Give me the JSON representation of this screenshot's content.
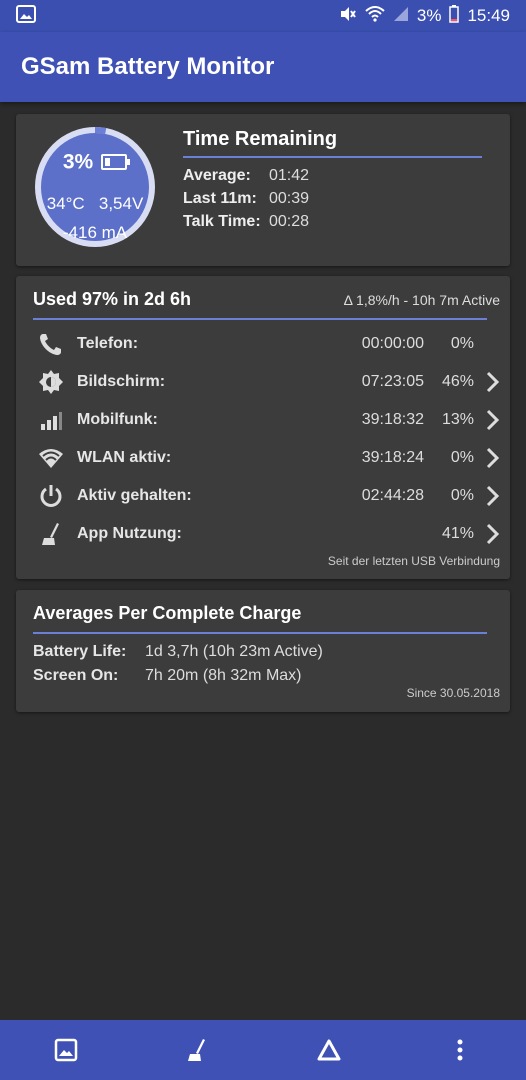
{
  "status_bar": {
    "battery_pct": "3%",
    "time": "15:49"
  },
  "app": {
    "title": "GSam Battery Monitor"
  },
  "gauge": {
    "percent": "3%",
    "level_fraction": 0.03,
    "temperature": "34°C",
    "voltage": "3,54V",
    "current": "-416 mA",
    "ring_color": "#d9ddf3",
    "fill_color": "#6b7fd7"
  },
  "time_remaining": {
    "title": "Time Remaining",
    "rows": [
      {
        "label": "Average:",
        "value": "01:42"
      },
      {
        "label": "Last 11m:",
        "value": "00:39"
      },
      {
        "label": "Talk Time:",
        "value": "00:28"
      }
    ]
  },
  "usage": {
    "title": "Used 97% in 2d 6h",
    "rate": "Δ 1,8%/h - 10h 7m Active",
    "rows": [
      {
        "icon": "phone-icon",
        "name": "Telefon:",
        "time": "00:00:00",
        "pct": "0%",
        "has_chevron": false
      },
      {
        "icon": "brightness-icon",
        "name": "Bildschirm:",
        "time": "07:23:05",
        "pct": "46%",
        "has_chevron": true
      },
      {
        "icon": "signal-icon",
        "name": "Mobilfunk:",
        "time": "39:18:32",
        "pct": "13%",
        "has_chevron": true
      },
      {
        "icon": "wifi-icon",
        "name": "WLAN aktiv:",
        "time": "39:18:24",
        "pct": "0%",
        "has_chevron": true
      },
      {
        "icon": "power-icon",
        "name": "Aktiv gehalten:",
        "time": "02:44:28",
        "pct": "0%",
        "has_chevron": true
      },
      {
        "icon": "broom-icon",
        "name": "App Nutzung:",
        "time": "",
        "pct": "41%",
        "has_chevron": true
      }
    ],
    "footer": "Seit der letzten USB Verbindung"
  },
  "averages": {
    "title": "Averages Per Complete Charge",
    "rows": [
      {
        "label": "Battery Life:",
        "value": "1d 3,7h (10h 23m Active)"
      },
      {
        "label": "Screen On:",
        "value": "7h 20m (8h 32m Max)"
      }
    ],
    "footer": "Since 30.05.2018"
  },
  "colors": {
    "primary": "#3f51b5",
    "accent_line": "#6b7fd7",
    "card_bg": "#3c3c3c",
    "page_bg": "#2b2b2b"
  },
  "bottom_nav": {
    "items": [
      "image-icon",
      "broom-icon",
      "delta-icon",
      "more-vert-icon"
    ]
  }
}
